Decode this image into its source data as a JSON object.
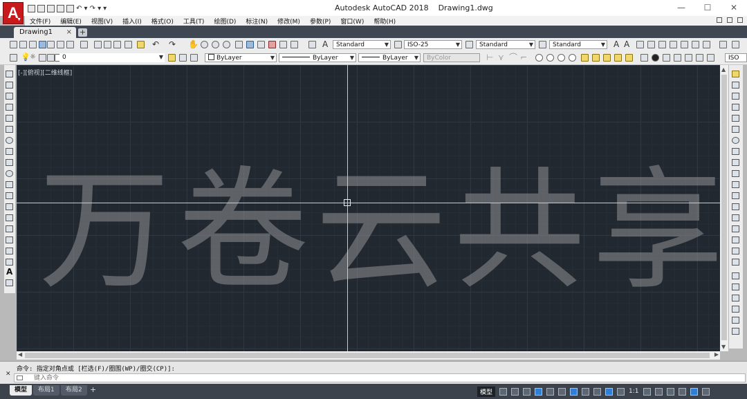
{
  "app": {
    "window_title": "Autodesk AutoCAD 2018    Drawing1.dwg",
    "logo_letter": "A",
    "min_glyph": "—",
    "max_glyph": "☐",
    "close_glyph": "✕"
  },
  "menu": {
    "items": [
      "文件(F)",
      "编辑(E)",
      "视图(V)",
      "插入(I)",
      "格式(O)",
      "工具(T)",
      "绘图(D)",
      "标注(N)",
      "修改(M)",
      "参数(P)",
      "窗口(W)",
      "帮助(H)"
    ]
  },
  "document": {
    "tab_label": "Drawing1",
    "tab_close": "×",
    "new_tab": "+"
  },
  "toolbar1": {
    "text_style": "Standard",
    "dim_style": "ISO-25",
    "table_style": "Standard",
    "multileader_style": "Standard",
    "text_glyph_a": "A",
    "text_glyph_b": "A"
  },
  "toolbar2": {
    "layer": "0",
    "color": "ByLayer",
    "linetype": "ByLayer",
    "lineweight": "ByLayer",
    "plot_style": "ByColor",
    "dim_style_right": "ISO"
  },
  "viewport": {
    "label": "[-][俯视][二维线框]",
    "watermark": "万卷云共享"
  },
  "command": {
    "history": "命令: 指定对角点或 [栏选(F)/圈围(WP)/圈交(CP)]:",
    "placeholder": "键入命令",
    "close_glyph": "✕"
  },
  "layouts": {
    "tabs": [
      "模型",
      "布局1",
      "布局2"
    ],
    "add": "+"
  },
  "status": {
    "model": "模型",
    "scale": "1:1"
  }
}
